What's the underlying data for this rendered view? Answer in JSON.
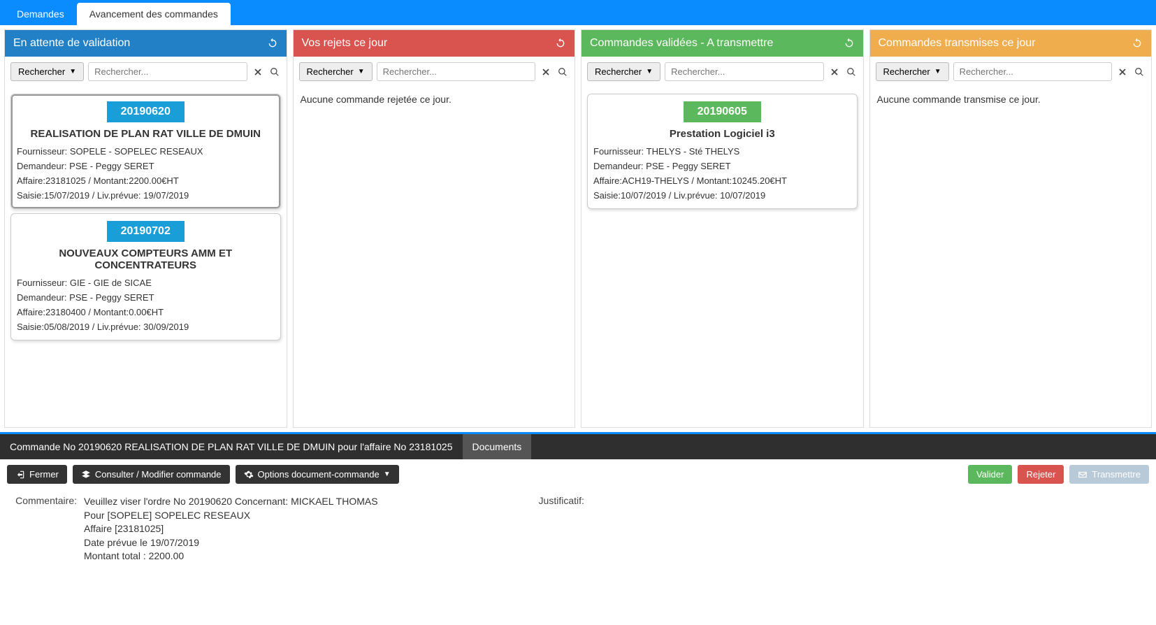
{
  "topTabs": {
    "demands": "Demandes",
    "progress": "Avancement des commandes"
  },
  "search": {
    "btnLabel": "Rechercher",
    "placeholder": "Rechercher..."
  },
  "columns": {
    "pending": {
      "title": "En attente de validation"
    },
    "rejected": {
      "title": "Vos rejets ce jour",
      "empty": "Aucune commande rejetée ce jour."
    },
    "validated": {
      "title": "Commandes validées - A transmettre"
    },
    "transmitted": {
      "title": "Commandes transmises ce jour",
      "empty": "Aucune commande transmise ce jour."
    }
  },
  "cards": {
    "c1": {
      "num": "20190620",
      "title": "REALISATION DE PLAN RAT VILLE DE DMUIN",
      "fournisseur": "Fournisseur: SOPELE - SOPELEC RESEAUX",
      "demandeur": "Demandeur: PSE - Peggy SERET",
      "affaire": "Affaire:23181025 / Montant:2200.00€HT",
      "saisie": "Saisie:15/07/2019 / Liv.prévue: 19/07/2019"
    },
    "c2": {
      "num": "20190702",
      "title": "NOUVEAUX COMPTEURS AMM ET CONCENTRATEURS",
      "fournisseur": "Fournisseur: GIE - GIE de SICAE",
      "demandeur": "Demandeur: PSE - Peggy SERET",
      "affaire": "Affaire:23180400 / Montant:0.00€HT",
      "saisie": "Saisie:05/08/2019 / Liv.prévue: 30/09/2019"
    },
    "c3": {
      "num": "20190605",
      "title": "Prestation Logiciel i3",
      "fournisseur": "Fournisseur: THELYS - Sté THELYS",
      "demandeur": "Demandeur: PSE - Peggy SERET",
      "affaire": "Affaire:ACH19-THELYS / Montant:10245.20€HT",
      "saisie": "Saisie:10/07/2019 / Liv.prévue: 10/07/2019"
    }
  },
  "dock": {
    "tabMain": "Commande No 20190620 REALISATION DE PLAN RAT VILLE DE DMUIN pour l'affaire No 23181025",
    "tabDocs": "Documents",
    "btnClose": "Fermer",
    "btnEdit": "Consulter / Modifier commande",
    "btnOptions": "Options document-commande",
    "btnValidate": "Valider",
    "btnReject": "Rejeter",
    "btnTransmit": "Transmettre",
    "commentLabel": "Commentaire:",
    "justifLabel": "Justificatif:",
    "comment": {
      "l1": "Veuillez viser l'ordre No 20190620 Concernant: MICKAEL THOMAS",
      "l2": "Pour [SOPELE] SOPELEC RESEAUX",
      "l3": "Affaire [23181025]",
      "l4": "Date prévue le 19/07/2019",
      "l5": "Montant total : 2200.00"
    }
  }
}
